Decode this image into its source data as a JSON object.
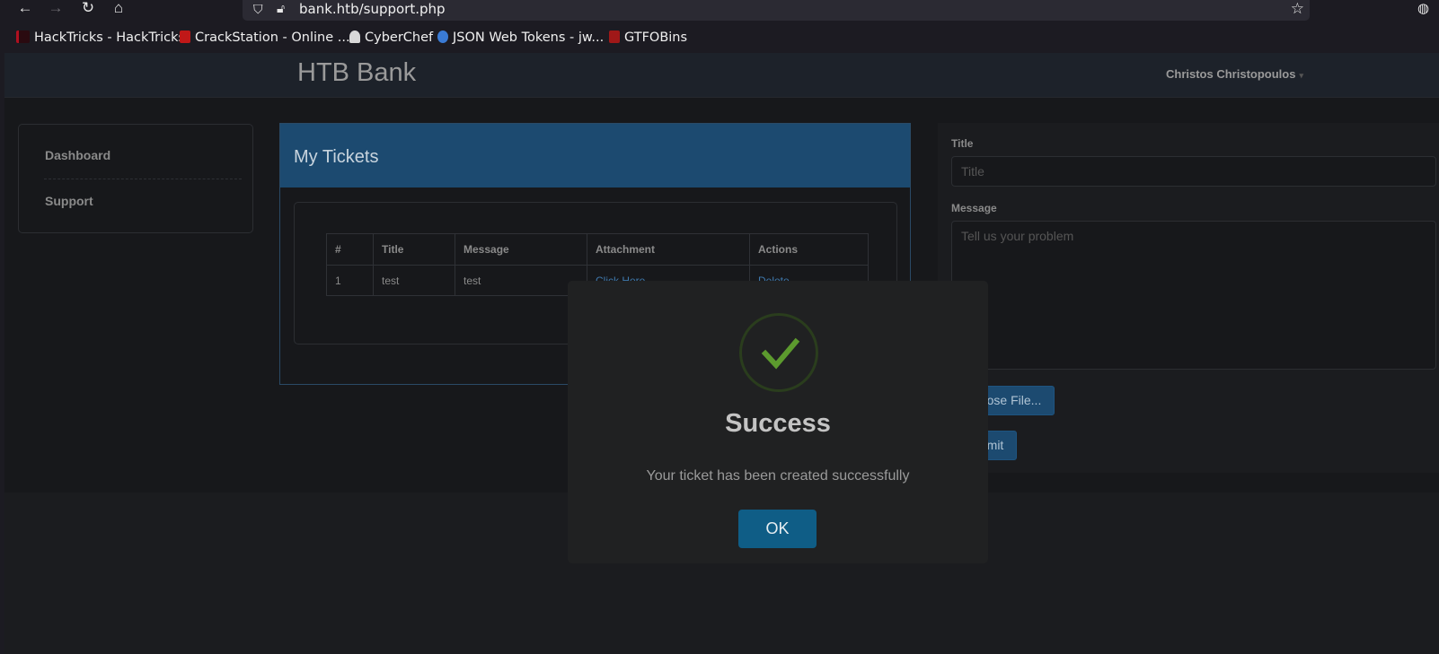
{
  "browser": {
    "url": "bank.htb/support.php",
    "bookmarks": [
      {
        "label": "HackTricks - HackTricks",
        "color": "#b01020"
      },
      {
        "label": "CrackStation - Online ...",
        "color": "#c01818"
      },
      {
        "label": "CyberChef",
        "color": "#d8d8d8"
      },
      {
        "label": "JSON Web Tokens - jw...",
        "color": "#3a7bd5"
      },
      {
        "label": "GTFOBins",
        "color": "#a01818"
      }
    ]
  },
  "header": {
    "brand": "HTB Bank",
    "user": "Christos Christopoulos"
  },
  "sidebar": {
    "items": [
      {
        "label": "Dashboard"
      },
      {
        "label": "Support"
      }
    ]
  },
  "tickets": {
    "title": "My Tickets",
    "columns": [
      "#",
      "Title",
      "Message",
      "Attachment",
      "Actions"
    ],
    "rows": [
      {
        "id": "1",
        "title": "test",
        "message": "test",
        "attachment": "Click Here",
        "action": "Delete"
      }
    ]
  },
  "form": {
    "title_label": "Title",
    "title_placeholder": "Title",
    "message_label": "Message",
    "message_placeholder": "Tell us your problem",
    "choose_file_label": "ose File...",
    "submit_label": "mit"
  },
  "modal": {
    "title": "Success",
    "message": "Your ticket has been created successfully",
    "ok_label": "OK",
    "icon": "checkmark-icon",
    "accent_color": "#5c9a2e"
  }
}
